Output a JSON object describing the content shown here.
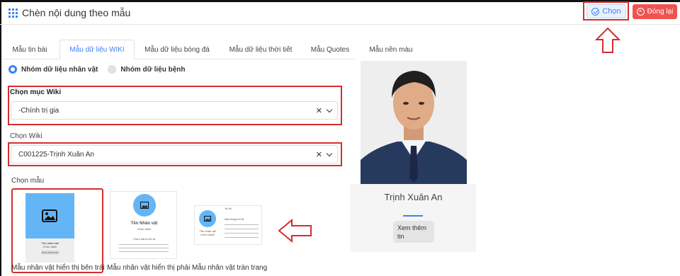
{
  "header": {
    "title": "Chèn nội dung theo mẫu",
    "select_button": "Chọn",
    "close_button": "Đóng lại"
  },
  "tabs": [
    {
      "label": "Mẫu tin bài",
      "active": false
    },
    {
      "label": "Mẫu dữ liệu WIKI",
      "active": true
    },
    {
      "label": "Mẫu dữ liệu bóng đá",
      "active": false
    },
    {
      "label": "Mẫu dữ liệu thời tiết",
      "active": false
    },
    {
      "label": "Mẫu Quotes",
      "active": false
    },
    {
      "label": "Mẫu nền màu",
      "active": false
    }
  ],
  "radios": [
    {
      "label": "Nhóm dữ liệu nhân vật",
      "selected": true
    },
    {
      "label": "Nhóm dữ liệu bệnh",
      "selected": false
    }
  ],
  "wiki_category": {
    "label": "Chọn mục Wiki",
    "value": "-Chính trị gia"
  },
  "wiki": {
    "label": "Chọn Wiki",
    "value": "C001225-Trịnh Xuân An"
  },
  "templates": {
    "label": "Chọn mẫu",
    "items": [
      {
        "caption": "Mẫu nhân vật hiển thị bên trái",
        "name_text": "Tên nhân vật",
        "sub_text": "Chức danh",
        "btn_text": "Xem thêm tin",
        "selected": true
      },
      {
        "caption": "Mẫu nhân vật hiển thị phải",
        "name_text": "Tên Nhân vật",
        "sub_text": "Chức danh",
        "desc_text": "Chức danh mô tả",
        "selected": false
      },
      {
        "caption": "Mẫu nhân vật tràn trang",
        "name_text": "Tên nhân vật",
        "sub_text": "Chức danh",
        "quote_mark": "““",
        "quote_text": "Nội dung mô tả",
        "selected": false
      }
    ]
  },
  "preview": {
    "name": "Trịnh Xuân An",
    "more_button": "Xem thêm tin"
  },
  "colors": {
    "accent": "#3b82f6",
    "danger": "#ef5350",
    "highlight": "#d32f2f"
  }
}
